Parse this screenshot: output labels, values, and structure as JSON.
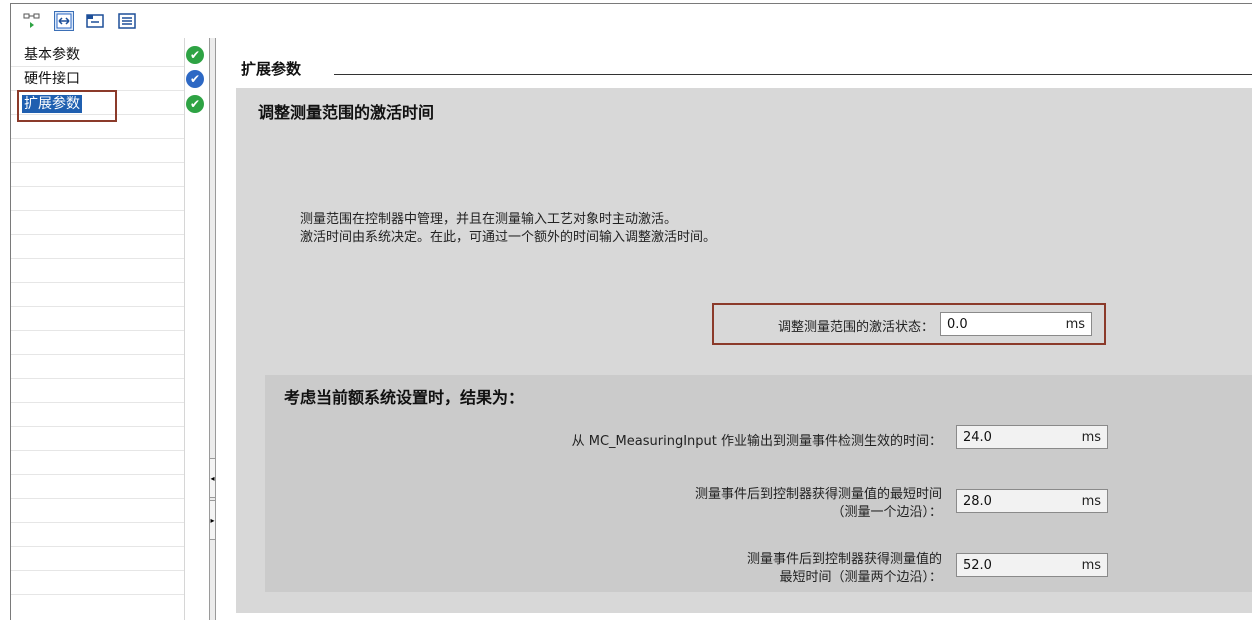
{
  "toolbar": {
    "icons": [
      "network-view-icon",
      "expand-collapse-icon",
      "folder-view-icon",
      "list-view-icon"
    ]
  },
  "navigation": {
    "items": [
      {
        "label": "基本参数",
        "status": "valid"
      },
      {
        "label": "硬件接口",
        "status": "info"
      },
      {
        "label": "扩展参数",
        "status": "valid",
        "selected": true
      }
    ]
  },
  "section": {
    "title": "扩展参数"
  },
  "panel": {
    "title": "调整测量范围的激活时间",
    "description_line1": "测量范围在控制器中管理，并且在测量输入工艺对象时主动激活。",
    "description_line2": "激活时间由系统决定。在此，可通过一个额外的时间输入调整激活时间。",
    "activation_field": {
      "label": "调整测量范围的激活状态：",
      "value": "0.0",
      "unit": "ms"
    }
  },
  "result": {
    "title": "考虑当前额系统设置时，结果为：",
    "rows": [
      {
        "label": "从 MC_MeasuringInput 作业输出到测量事件检测生效的时间：",
        "value": "24.0",
        "unit": "ms"
      },
      {
        "label_line1": "测量事件后到控制器获得测量值的最短时间",
        "label_line2": "（测量一个边沿）：",
        "value": "28.0",
        "unit": "ms"
      },
      {
        "label_line1": "测量事件后到控制器获得测量值的",
        "label_line2": "最短时间（测量两个边沿）：",
        "value": "52.0",
        "unit": "ms"
      }
    ]
  },
  "colors": {
    "selected": "#1f5fb0",
    "valid": "#2ea344",
    "info": "#2d68c4",
    "highlight_box": "#8b3a2a",
    "panel_bg": "#d8d8d8"
  }
}
